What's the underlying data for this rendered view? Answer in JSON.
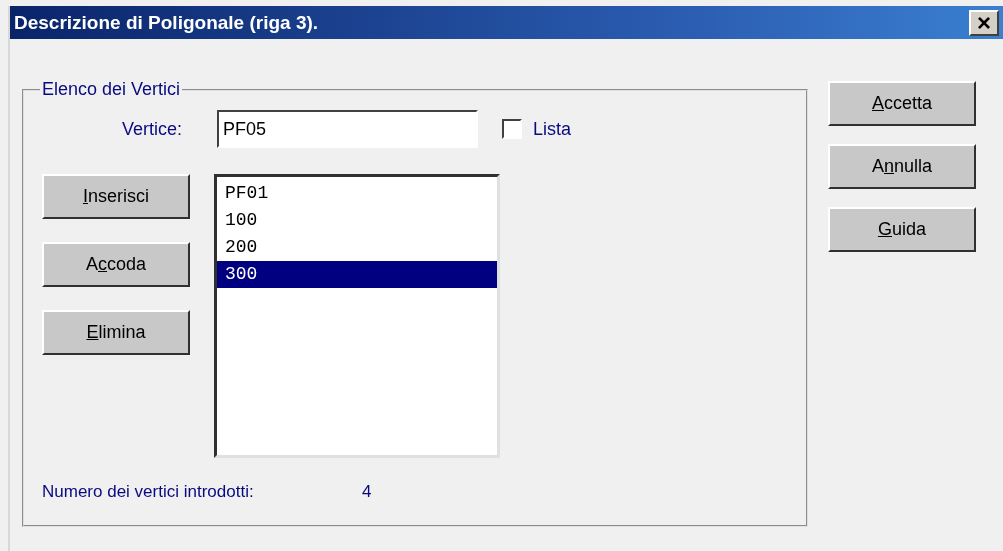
{
  "window": {
    "title": "Descrizione di Poligonale  (riga 3).",
    "close": "×"
  },
  "group": {
    "title": "Elenco dei Vertici"
  },
  "vertex_field": {
    "label": "Vertice:",
    "value": "PF05"
  },
  "list_checkbox": {
    "label": "Lista",
    "checked": false
  },
  "left_buttons": [
    {
      "underlined_key": "I",
      "rest": "nserisci"
    },
    {
      "lead": "A",
      "underlined_key": "c",
      "rest": "coda"
    },
    {
      "underlined_key": "E",
      "rest": "limina"
    }
  ],
  "vertices": [
    {
      "text": "PF01",
      "selected": false
    },
    {
      "text": "100",
      "selected": false
    },
    {
      "text": "200",
      "selected": false
    },
    {
      "text": "300",
      "selected": true
    }
  ],
  "count": {
    "label": "Numero dei vertici introdotti:",
    "value": "4"
  },
  "right_buttons": [
    {
      "underlined_key": "A",
      "rest": "ccetta"
    },
    {
      "lead": "A",
      "underlined_key": "n",
      "rest": "nulla"
    },
    {
      "underlined_key": "G",
      "rest": "uida"
    }
  ]
}
